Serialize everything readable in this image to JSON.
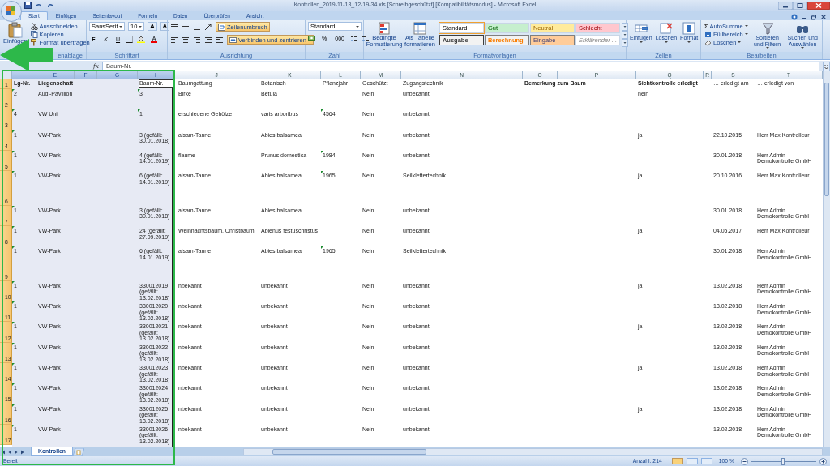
{
  "window": {
    "title": "Kontrollen_2019-11-13_12-19-34.xls  [Schreibgeschützt]  [Kompatibilitätsmodus] - Microsoft Excel"
  },
  "ribbon_tabs": [
    {
      "label": "Start",
      "selected": true
    },
    {
      "label": "Einfügen",
      "selected": false
    },
    {
      "label": "Seitenlayout",
      "selected": false
    },
    {
      "label": "Formeln",
      "selected": false
    },
    {
      "label": "Daten",
      "selected": false
    },
    {
      "label": "Überprüfen",
      "selected": false
    },
    {
      "label": "Ansicht",
      "selected": false
    }
  ],
  "ribbon": {
    "clipboard": {
      "paste": "Einfügen",
      "items": [
        "Ausschneiden",
        "Kopieren",
        "Format übertragen"
      ],
      "label": "enablage"
    },
    "font": {
      "name": "SansSerif",
      "size": "10",
      "size_buttons": [
        "A",
        "A"
      ],
      "format_buttons": [
        {
          "label": "F",
          "kind": "bold"
        },
        {
          "label": "K",
          "kind": "italic"
        },
        {
          "label": "U",
          "kind": "underline"
        }
      ],
      "font_color_label": "A",
      "label": "Schriftart"
    },
    "alignment": {
      "toggles": [
        {
          "label": "Zeilenumbruch",
          "on": true
        },
        {
          "label": "Verbinden und zentrieren",
          "on": true
        }
      ],
      "label": "Ausrichtung"
    },
    "number": {
      "format": "Standard",
      "buttons": [
        "%",
        "000"
      ],
      "label": "Zahl"
    },
    "style_buttons": [
      "Bedingte Formatierung",
      "Als Tabelle formatieren"
    ],
    "styles": {
      "cells": [
        {
          "label": "Standard",
          "kind": "standard",
          "selected": true
        },
        {
          "label": "Gut",
          "kind": "good",
          "selected": false
        },
        {
          "label": "Neutral",
          "kind": "neutral",
          "selected": false
        },
        {
          "label": "Schlecht",
          "kind": "bad",
          "selected": false
        },
        {
          "label": "Ausgabe",
          "kind": "output",
          "selected": false
        },
        {
          "label": "Berechnung",
          "kind": "calculation",
          "selected": false
        },
        {
          "label": "Eingabe",
          "kind": "input",
          "selected": false
        },
        {
          "label": "Erklärender ...",
          "kind": "explanatory",
          "selected": false
        }
      ],
      "label": "Formatvorlagen"
    },
    "cells": {
      "buttons": [
        "Einfügen",
        "Löschen",
        "Format"
      ],
      "label": "Zellen"
    },
    "editing": {
      "items": [
        {
          "icon": "Σ",
          "label": "AutoSumme"
        },
        {
          "label": "Füllbereich"
        },
        {
          "label": "Löschen"
        }
      ],
      "buttons": [
        "Sortieren und Filtern",
        "Suchen und Auswählen"
      ],
      "label": "Bearbeiten"
    }
  },
  "formula_bar": {
    "function_label": "fx",
    "content": "Baum-Nr."
  },
  "sheet": {
    "columns": [
      {
        "selected": true
      },
      {
        "letter": "E",
        "selected": true
      },
      {
        "letter": "F",
        "selected": true
      },
      {
        "letter": "G",
        "selected": true
      },
      {
        "letter": "I",
        "selected": true
      },
      {
        "letter": "J",
        "selected": false
      },
      {
        "letter": "K",
        "selected": false
      },
      {
        "letter": "L",
        "selected": false
      },
      {
        "letter": "M",
        "selected": false
      },
      {
        "letter": "N",
        "selected": false
      },
      {
        "letter": "O",
        "selected": false
      },
      {
        "letter": "P",
        "selected": false
      },
      {
        "letter": "Q",
        "selected": false
      },
      {
        "letter": "R",
        "selected": false
      },
      {
        "letter": "S",
        "selected": false
      },
      {
        "letter": "T",
        "selected": false
      }
    ],
    "rows": [
      {
        "number": "1",
        "cells": [
          {
            "text": "Lg-Nr.",
            "bold": true
          },
          {
            "text": "Liegenschaft",
            "bold": true
          },
          null,
          null,
          {
            "text": "Baum-Nr.",
            "active": true
          },
          "Baumgattung",
          "Botanisch",
          "Pflanzjahr",
          "Geschützt",
          "Zugangstechnik",
          {
            "text": "Bemerkung zum Baum",
            "bold": true
          },
          null,
          {
            "text": "Sichtkontrolle erledigt",
            "bold": true
          },
          null,
          "… erledigt am",
          "… erledigt von"
        ]
      },
      {
        "number": "2",
        "cells": [
          {
            "text": "2",
            "flagged": true
          },
          "Audi-Pavillion",
          null,
          null,
          {
            "text": "3",
            "flagged": true
          },
          "Birke",
          "Betula",
          null,
          "Nein",
          "unbekannt",
          null,
          null,
          "nein",
          null,
          null,
          null
        ]
      },
      {
        "number": "3",
        "cells": [
          {
            "text": "4",
            "flagged": true
          },
          "VW Uni",
          null,
          null,
          {
            "text": "1",
            "flagged": true
          },
          "erschiedene Gehölze",
          "varis arboribus",
          {
            "text": "4564",
            "flagged": true
          },
          "Nein",
          "unbekannt",
          null,
          null,
          null,
          null,
          null,
          null
        ]
      },
      {
        "number": "4",
        "cells": [
          {
            "text": "1",
            "flagged": true
          },
          "VW-Park",
          null,
          null,
          "3 (gefällt: 30.01.2018)",
          "alsam-Tanne",
          "Abies balsamea",
          null,
          "Nein",
          "unbekannt",
          null,
          null,
          "ja",
          null,
          "22.10.2015",
          "Herr Max Kontrolleur"
        ]
      },
      {
        "number": "5",
        "cells": [
          {
            "text": "1",
            "flagged": true
          },
          "VW-Park",
          null,
          null,
          "4 (gefällt: 14.01.2019)",
          "flaume",
          "Prunus domestica",
          {
            "text": "1984",
            "flagged": true
          },
          "Nein",
          "unbekannt",
          null,
          null,
          null,
          null,
          "30.01.2018",
          "Herr Admin Demokontrolle GmbH"
        ]
      },
      {
        "number": "6",
        "cells": [
          {
            "text": "1",
            "flagged": true
          },
          "VW-Park",
          null,
          null,
          "6 (gefällt: 14.01.2019)",
          "alsam-Tanne",
          "Abies balsamea",
          {
            "text": "1965",
            "flagged": true
          },
          "Nein",
          "Seilklettertechnik",
          null,
          null,
          "ja",
          null,
          "20.10.2016",
          "Herr Max Kontrolleur"
        ]
      },
      {
        "number": "7",
        "cells": [
          {
            "text": "1",
            "flagged": true
          },
          "VW-Park",
          null,
          null,
          "3 (gefällt: 30.01.2018)",
          "alsam-Tanne",
          "Abies balsamea",
          null,
          "Nein",
          "unbekannt",
          null,
          null,
          null,
          null,
          "30.01.2018",
          "Herr Admin Demokontrolle GmbH"
        ]
      },
      {
        "number": "8",
        "cells": [
          {
            "text": "1",
            "flagged": true
          },
          "VW-Park",
          null,
          null,
          "24 (gefällt: 27.09.2019)",
          "Weihnachtsbaum, Christbaum",
          "Abienus festuschristus",
          null,
          "Nein",
          "unbekannt",
          null,
          null,
          "ja",
          null,
          "04.05.2017",
          "Herr Max Kontrolleur"
        ]
      },
      {
        "number": "9",
        "cells": [
          {
            "text": "1",
            "flagged": true
          },
          "VW-Park",
          null,
          null,
          "6 (gefällt: 14.01.2019)",
          "alsam-Tanne",
          "Abies balsamea",
          {
            "text": "1965",
            "flagged": true
          },
          "Nein",
          "Seilklettertechnik",
          null,
          null,
          null,
          null,
          "30.01.2018",
          "Herr Admin Demokontrolle GmbH"
        ]
      },
      {
        "number": "10",
        "cells": [
          {
            "text": "1",
            "flagged": true
          },
          "VW-Park",
          null,
          null,
          "330012019 (gefällt: 13.02.2018)",
          "nbekannt",
          "unbekannt",
          null,
          "Nein",
          "unbekannt",
          null,
          null,
          "ja",
          null,
          "13.02.2018",
          "Herr Admin Demokontrolle GmbH"
        ]
      },
      {
        "number": "11",
        "cells": [
          {
            "text": "1",
            "flagged": true
          },
          "VW-Park",
          null,
          null,
          "330012020 (gefällt: 13.02.2018)",
          "nbekannt",
          "unbekannt",
          null,
          "Nein",
          "unbekannt",
          null,
          null,
          null,
          null,
          "13.02.2018",
          "Herr Admin Demokontrolle GmbH"
        ]
      },
      {
        "number": "12",
        "cells": [
          {
            "text": "1",
            "flagged": true
          },
          "VW-Park",
          null,
          null,
          "330012021 (gefällt: 13.02.2018)",
          "nbekannt",
          "unbekannt",
          null,
          "Nein",
          "unbekannt",
          null,
          null,
          "ja",
          null,
          "13.02.2018",
          "Herr Admin Demokontrolle GmbH"
        ]
      },
      {
        "number": "13",
        "cells": [
          {
            "text": "1",
            "flagged": true
          },
          "VW-Park",
          null,
          null,
          "330012022 (gefällt: 13.02.2018)",
          "nbekannt",
          "unbekannt",
          null,
          "Nein",
          "unbekannt",
          null,
          null,
          null,
          null,
          "13.02.2018",
          "Herr Admin Demokontrolle GmbH"
        ]
      },
      {
        "number": "14",
        "cells": [
          {
            "text": "1",
            "flagged": true
          },
          "VW-Park",
          null,
          null,
          "330012023 (gefällt: 13.02.2018)",
          "nbekannt",
          "unbekannt",
          null,
          "Nein",
          "unbekannt",
          null,
          null,
          "ja",
          null,
          "13.02.2018",
          "Herr Admin Demokontrolle GmbH"
        ]
      },
      {
        "number": "15",
        "cells": [
          {
            "text": "1",
            "flagged": true
          },
          "VW-Park",
          null,
          null,
          "330012024 (gefällt: 13.02.2018)",
          "nbekannt",
          "unbekannt",
          null,
          "Nein",
          "unbekannt",
          null,
          null,
          null,
          null,
          "13.02.2018",
          "Herr Admin Demokontrolle GmbH"
        ]
      },
      {
        "number": "16",
        "cells": [
          {
            "text": "1",
            "flagged": true
          },
          "VW-Park",
          null,
          null,
          "330012025 (gefällt: 13.02.2018)",
          "nbekannt",
          "unbekannt",
          null,
          "Nein",
          "unbekannt",
          null,
          null,
          "ja",
          null,
          "13.02.2018",
          "Herr Admin Demokontrolle GmbH"
        ]
      },
      {
        "number": "17",
        "cells": [
          {
            "text": "1",
            "flagged": true
          },
          "VW-Park",
          null,
          null,
          "330012026 (gefällt: 13.02.2018)",
          "nbekannt",
          "unbekannt",
          null,
          "Nein",
          "unbekannt",
          null,
          null,
          null,
          null,
          "13.02.2018",
          "Herr Admin Demokontrolle GmbH"
        ]
      }
    ]
  },
  "sheet_tabs": [
    {
      "label": "Kontrollen",
      "selected": true
    }
  ],
  "status_bar": {
    "mode": "Bereit",
    "count": "Anzahl: 214",
    "views": [
      {
        "selected": true
      },
      {
        "selected": false
      },
      {
        "selected": false
      }
    ],
    "zoom": {
      "reading": "100 %",
      "level": 0.5
    }
  }
}
